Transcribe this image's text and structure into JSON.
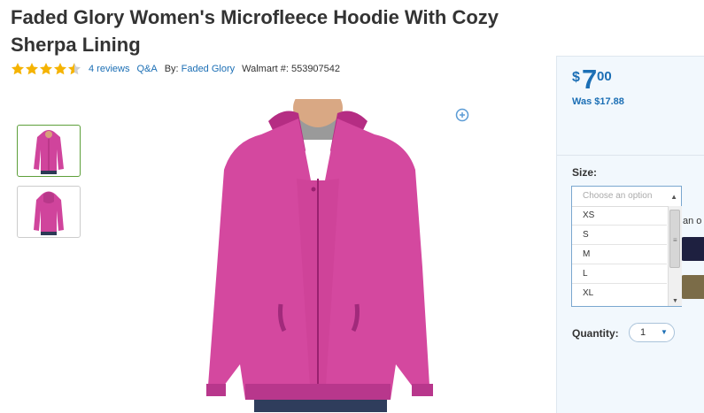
{
  "product": {
    "title": "Faded Glory Women's Microfleece Hoodie With Cozy Sherpa Lining",
    "rating": 4.5,
    "reviews_link": "4 reviews",
    "qa_link": "Q&A",
    "by_label": "By:",
    "brand": "Faded Glory",
    "walmart_number": "Walmart #: 553907542"
  },
  "price": {
    "currency": "$",
    "whole": "7",
    "cents": "00",
    "was": "Was $17.88"
  },
  "size": {
    "label": "Size:",
    "placeholder": "Choose an option",
    "options": [
      "XS",
      "S",
      "M",
      "L",
      "XL"
    ]
  },
  "color": {
    "label_fragment": "an o"
  },
  "quantity": {
    "label": "Quantity:",
    "value": "1"
  },
  "colors": {
    "accent": "#1c6fb5",
    "thumb_active_border": "#5d9f3a",
    "hoodie": "#d0449c",
    "swatch_navy": "#1e2040",
    "swatch_khaki": "#7b6c48"
  }
}
